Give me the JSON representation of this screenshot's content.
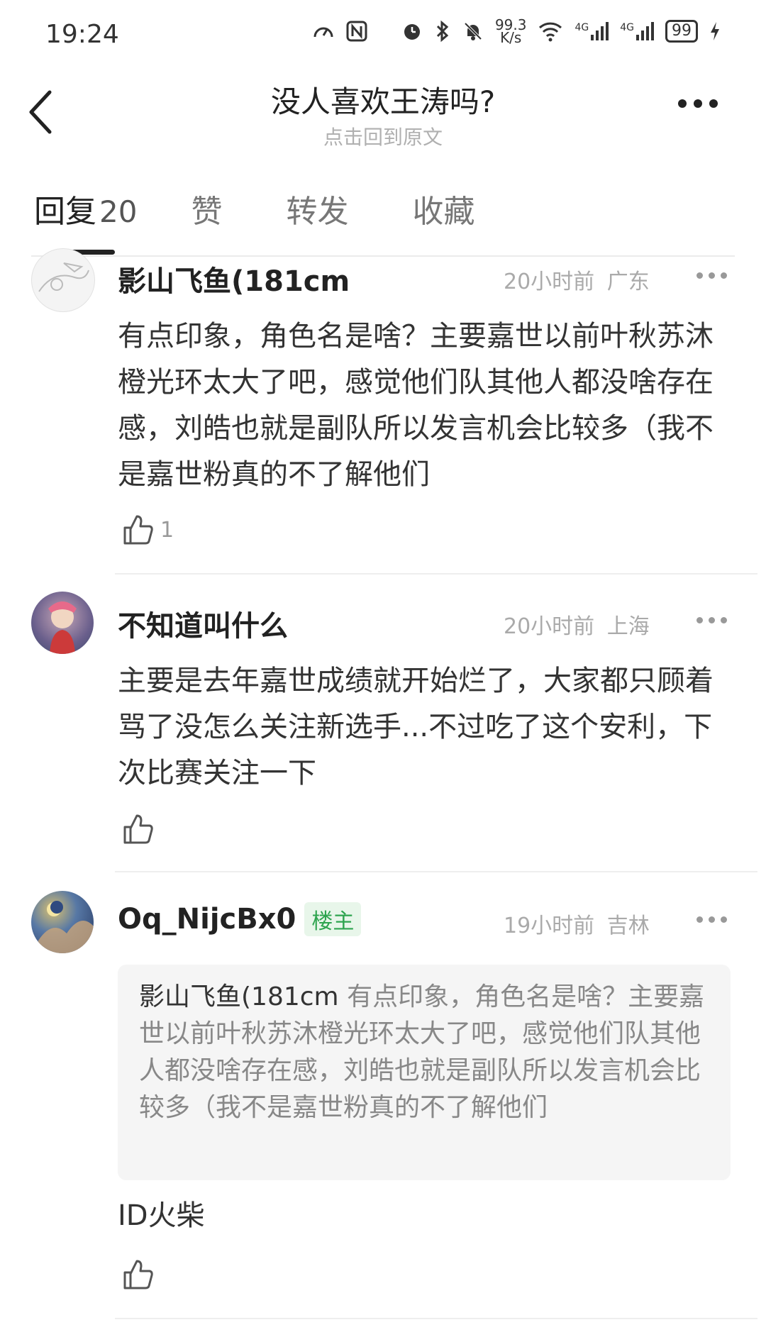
{
  "status_bar": {
    "time": "19:24",
    "net_speed_value": "99.3",
    "net_speed_unit": "K/s",
    "signal1": "4G",
    "signal2": "4G",
    "battery": "99"
  },
  "header": {
    "title": "没人喜欢王涛吗?",
    "subtitle": "点击回到原文"
  },
  "tabs": [
    {
      "label": "回复",
      "count": "20"
    },
    {
      "label": "赞"
    },
    {
      "label": "转发"
    },
    {
      "label": "收藏"
    }
  ],
  "comments": [
    {
      "username": "影山飞鱼(181cm",
      "time": "20小时前",
      "location": "广东",
      "text": "有点印象，角色名是啥？主要嘉世以前叶秋苏沐橙光环太大了吧，感觉他们队其他人都没啥存在感，刘皓也就是副队所以发言机会比较多（我不是嘉世粉真的不了解他们",
      "likes": "1"
    },
    {
      "username": "不知道叫什么",
      "time": "20小时前",
      "location": "上海",
      "text": "主要是去年嘉世成绩就开始烂了，大家都只顾着骂了没怎么关注新选手...不过吃了这个安利，下次比赛关注一下"
    },
    {
      "username": "Oq_NijcBx0",
      "badge": "楼主",
      "time": "19小时前",
      "location": "吉林",
      "quote_name": "影山飞鱼(181cm",
      "quote_text": "有点印象，角色名是啥？主要嘉世以前叶秋苏沐橙光环太大了吧，感觉他们队其他人都没啥存在感，刘皓也就是副队所以发言机会比较多（我不是嘉世粉真的不了解他们",
      "text": "ID火柴"
    }
  ],
  "colors": {
    "badge_green": "#2ea44f",
    "badge_bg": "#e8f6ea",
    "quote_bg": "#f5f5f5"
  }
}
